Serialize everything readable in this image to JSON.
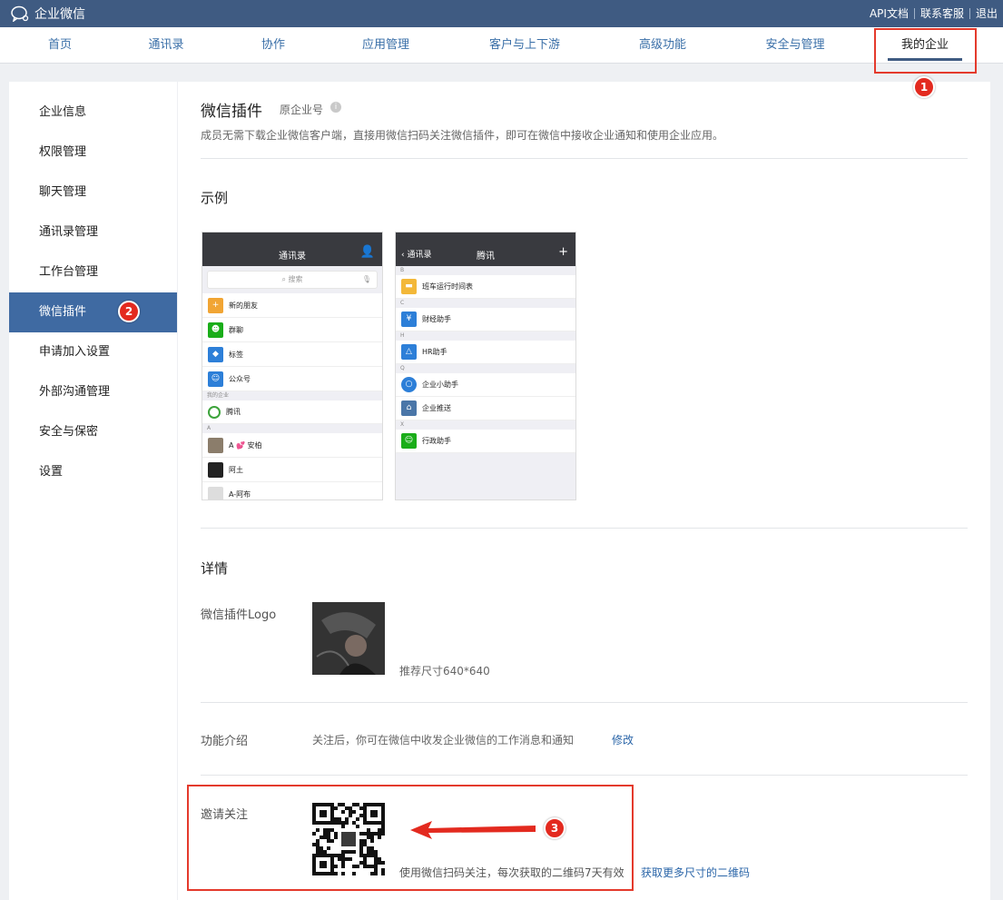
{
  "topbar": {
    "brand": "企业微信",
    "links": [
      "API文档",
      "联系客服",
      "退出"
    ]
  },
  "nav": {
    "tabs": [
      "首页",
      "通讯录",
      "协作",
      "应用管理",
      "客户与上下游",
      "高级功能",
      "安全与管理",
      "我的企业"
    ],
    "active_index": 7
  },
  "annotations": [
    "1",
    "2",
    "3"
  ],
  "sidebar": {
    "items": [
      "企业信息",
      "权限管理",
      "聊天管理",
      "通讯录管理",
      "工作台管理",
      "微信插件",
      "申请加入设置",
      "外部沟通管理",
      "安全与保密",
      "设置"
    ],
    "active_index": 5
  },
  "main": {
    "title": "微信插件",
    "subtitle": "原企业号",
    "description": "成员无需下载企业微信客户端，直接用微信扫码关注微信插件，即可在微信中接收企业通知和使用企业应用。",
    "example_heading": "示例",
    "details_heading": "详情",
    "logo_label": "微信插件Logo",
    "logo_hint": "推荐尺寸640*640",
    "intro_label": "功能介绍",
    "intro_text": "关注后，你可在微信中收发企业微信的工作消息和通知",
    "intro_edit": "修改",
    "invite_label": "邀请关注",
    "invite_hint": "使用微信扫码关注，每次获取的二维码7天有效",
    "invite_more": "获取更多尺寸的二维码"
  },
  "phone1": {
    "title": "通讯录",
    "search": "搜索",
    "rows_top": [
      "新的朋友",
      "群聊",
      "标签",
      "公众号"
    ],
    "group_company": "我的企业",
    "company": "腾讯",
    "group_a": "A",
    "contacts": [
      "A 💕 安柏",
      "阿土",
      "A-阿布"
    ]
  },
  "phone2": {
    "back": "通讯录",
    "title": "腾讯",
    "plus": "+",
    "groups": [
      "B",
      "C",
      "H",
      "Q",
      "X"
    ],
    "apps": [
      "班车运行时间表",
      "财经助手",
      "HR助手",
      "企业小助手",
      "企业推送",
      "行政助手"
    ]
  },
  "colors": {
    "topbar": "#3f5b82",
    "accent": "#3f6aa2",
    "link": "#2a65a8",
    "annotation_red": "#e32a1f"
  }
}
